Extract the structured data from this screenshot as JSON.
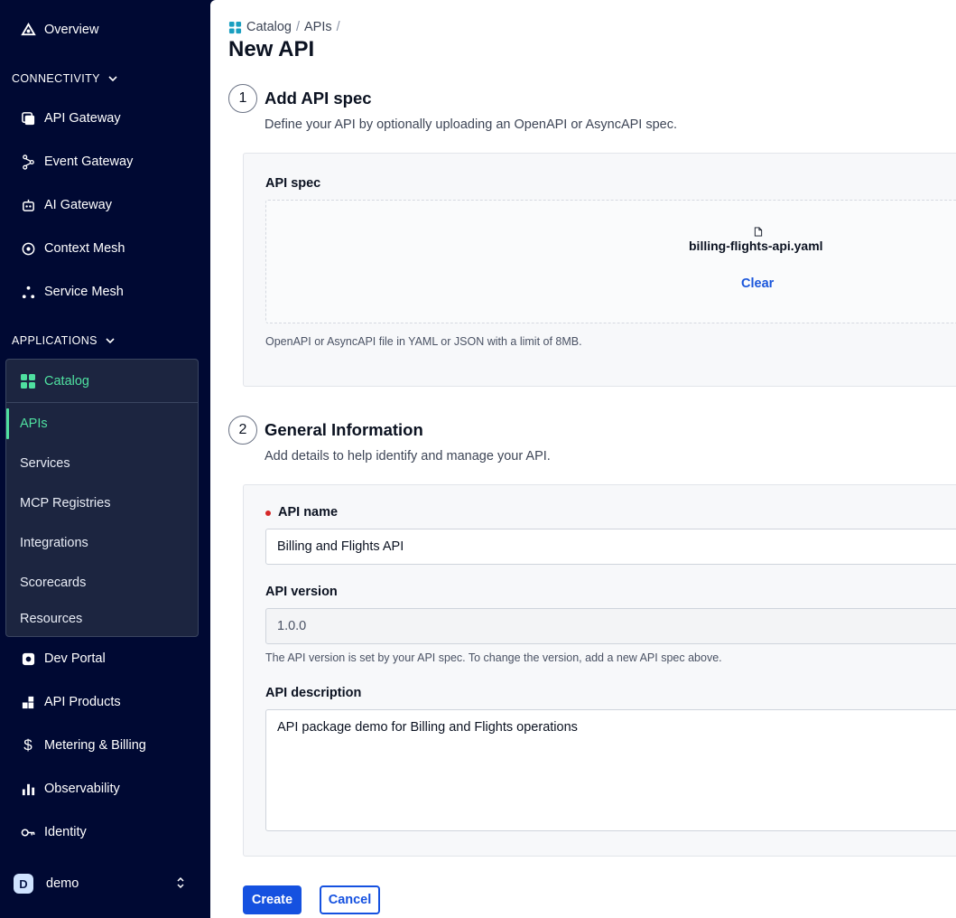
{
  "sidebar": {
    "top_items": [
      {
        "label": "Overview",
        "icon": "overview-icon"
      }
    ],
    "connectivity": {
      "label": "CONNECTIVITY",
      "items": [
        {
          "label": "API Gateway",
          "icon": "api-gateway-icon"
        },
        {
          "label": "Event Gateway",
          "icon": "event-gateway-icon"
        },
        {
          "label": "AI Gateway",
          "icon": "ai-gateway-icon"
        },
        {
          "label": "Context Mesh",
          "icon": "context-mesh-icon"
        },
        {
          "label": "Service Mesh",
          "icon": "service-mesh-icon"
        }
      ]
    },
    "applications": {
      "label": "APPLICATIONS",
      "catalog": {
        "label": "Catalog",
        "items": [
          {
            "label": "APIs",
            "active": true
          },
          {
            "label": "Services"
          },
          {
            "label": "MCP Registries"
          },
          {
            "label": "Integrations"
          },
          {
            "label": "Scorecards"
          },
          {
            "label": "Resources"
          }
        ]
      },
      "items": [
        {
          "label": "Dev Portal",
          "icon": "dev-portal-icon"
        },
        {
          "label": "API Products",
          "icon": "api-products-icon"
        },
        {
          "label": "Metering & Billing",
          "icon": "dollar-icon"
        },
        {
          "label": "Observability",
          "icon": "bar-chart-icon"
        },
        {
          "label": "Identity",
          "icon": "key-icon"
        }
      ]
    },
    "user": {
      "initial": "D",
      "name": "demo"
    }
  },
  "main": {
    "breadcrumb": [
      "Catalog",
      "APIs"
    ],
    "breadcrumb_sep": "/",
    "title": "New API",
    "step1": {
      "number": "1",
      "title": "Add API spec",
      "description": "Define your API by optionally uploading an OpenAPI or AsyncAPI spec.",
      "field_label": "API spec",
      "file_name": "billing-flights-api.yaml",
      "clear_label": "Clear",
      "help": "OpenAPI or AsyncAPI file in YAML or JSON with a limit of 8MB."
    },
    "step2": {
      "number": "2",
      "title": "General Information",
      "description": "Add details to help identify and manage your API.",
      "name_label": "API name",
      "name_value": "Billing and Flights API",
      "version_label": "API version",
      "version_value": "1.0.0",
      "version_help": "The API version is set by your API spec. To change the version, add a new API spec above.",
      "description_label": "API description",
      "description_value": "API package demo for Billing and Flights operations"
    },
    "actions": {
      "create": "Create",
      "cancel": "Cancel"
    }
  },
  "colors": {
    "sidebar_bg": "#000933",
    "accent_green": "#4fe0a0",
    "primary_blue": "#1551e0",
    "required_red": "#d62828"
  }
}
